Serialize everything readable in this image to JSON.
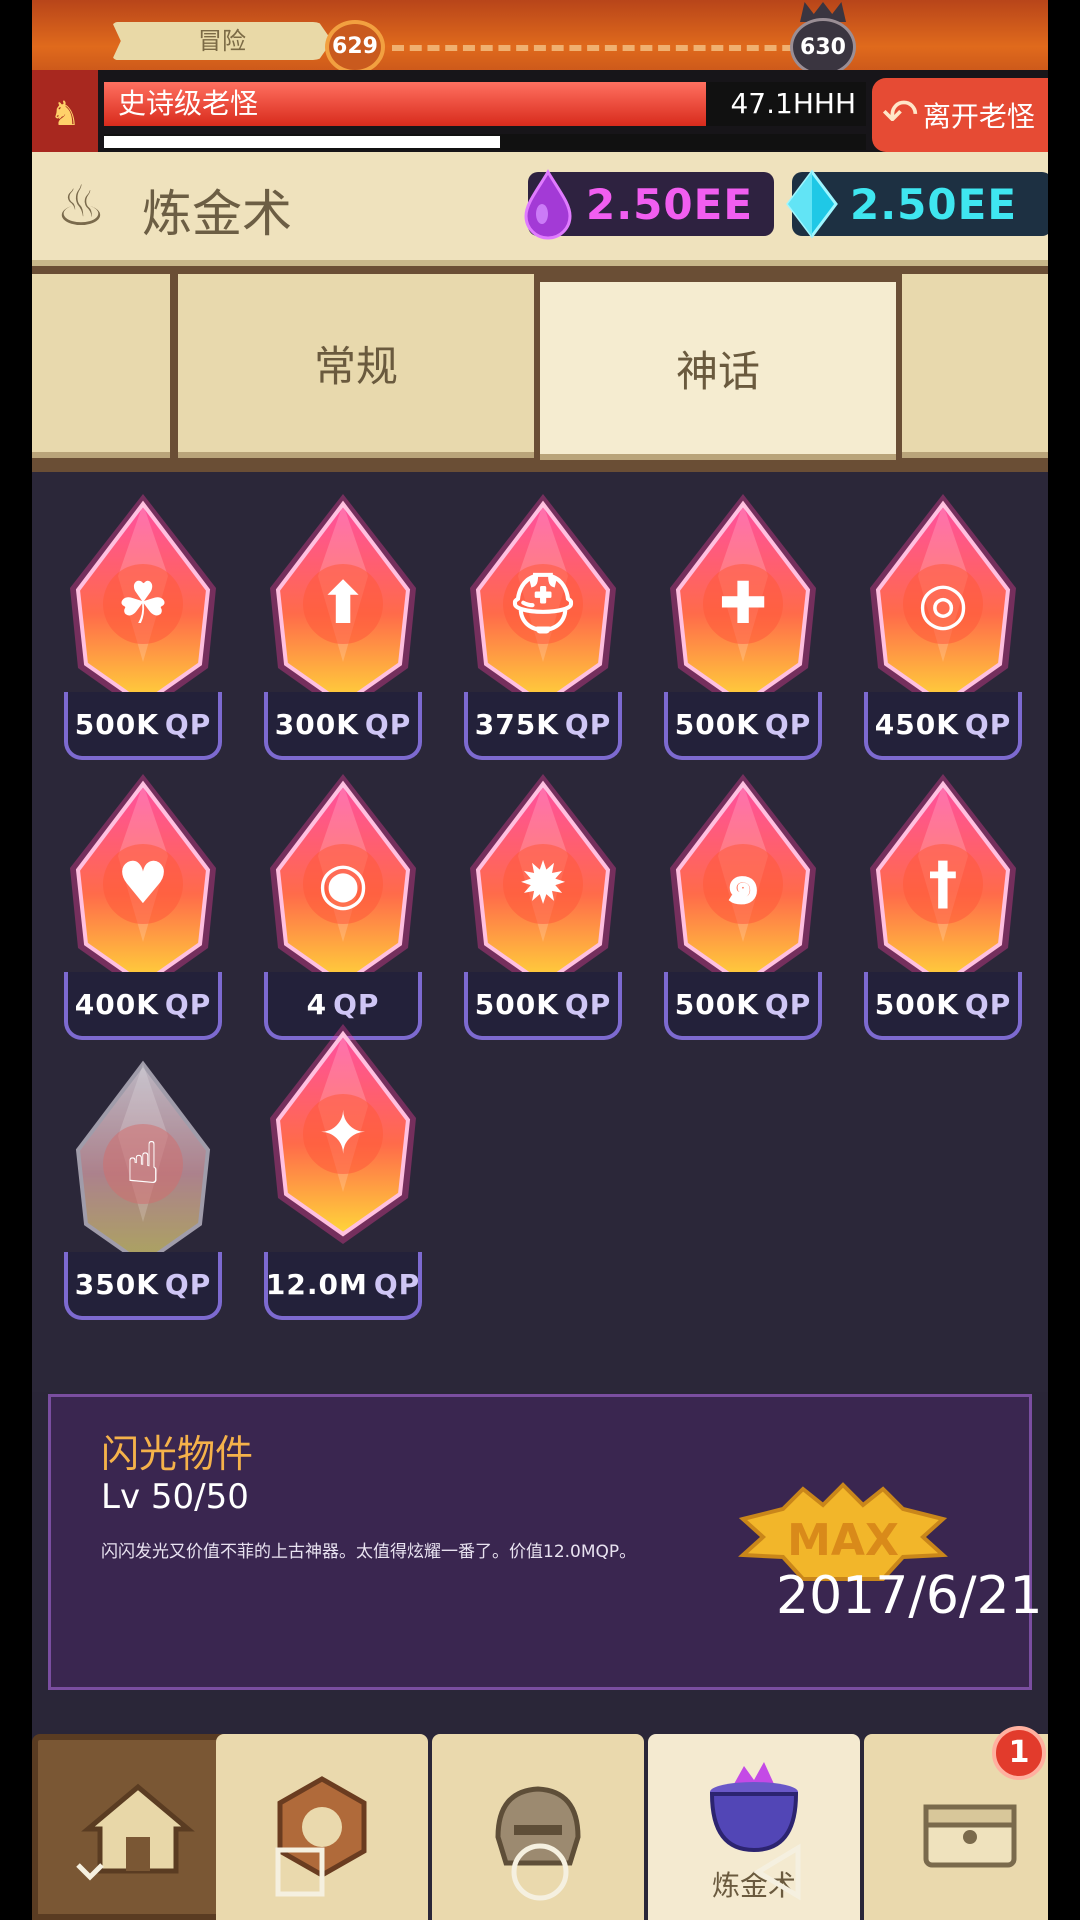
{
  "top_bar": {
    "mode_label": "冒险",
    "current_stage": "629",
    "boss_stage": "630"
  },
  "boss": {
    "name": "史诗级老怪",
    "hp_value": "47.1HHH",
    "hp_fraction": 0.79,
    "timer_fraction": 0.52,
    "leave_label": "离开老怪"
  },
  "header": {
    "title": "炼金术",
    "currencies": [
      {
        "icon": "purple-drop-icon",
        "amount": "2.50EE",
        "color": "#f15ef0"
      },
      {
        "icon": "cyan-gem-icon",
        "amount": "2.50EE",
        "color": "#3fe6f0"
      }
    ]
  },
  "tabs": {
    "normal": "常规",
    "myth": "神话",
    "selected": "神话"
  },
  "artifacts": [
    {
      "icon": "mushroom-icon",
      "price": "500K",
      "unit": "QP"
    },
    {
      "icon": "up-arrow-icon",
      "price": "300K",
      "unit": "QP"
    },
    {
      "icon": "helmet-icon",
      "price": "375K",
      "unit": "QP"
    },
    {
      "icon": "heart-plus-icon",
      "price": "500K",
      "unit": "QP"
    },
    {
      "icon": "portal-icon",
      "price": "450K",
      "unit": "QP"
    },
    {
      "icon": "heal-sword-icon",
      "price": "400K",
      "unit": "QP"
    },
    {
      "icon": "coins-icon",
      "price": "4",
      "unit": "QP"
    },
    {
      "icon": "shield-burst-icon",
      "price": "500K",
      "unit": "QP"
    },
    {
      "icon": "swirl-icon",
      "price": "500K",
      "unit": "QP"
    },
    {
      "icon": "sword-icon",
      "price": "500K",
      "unit": "QP"
    },
    {
      "icon": "pointing-hand-icon",
      "price": "350K",
      "unit": "QP"
    },
    {
      "icon": "sparkle-icon",
      "price": "12.0M",
      "unit": "QP"
    }
  ],
  "detail": {
    "name": "闪光物件",
    "level": "Lv 50/50",
    "description": "闪闪发光又价值不菲的上古神器。太值得炫耀一番了。价值12.0MQP。",
    "badge": "MAX"
  },
  "timestamp": "2017/6/21",
  "bottom_nav": {
    "alchemy_label": "炼金术",
    "notification_count": "1"
  }
}
